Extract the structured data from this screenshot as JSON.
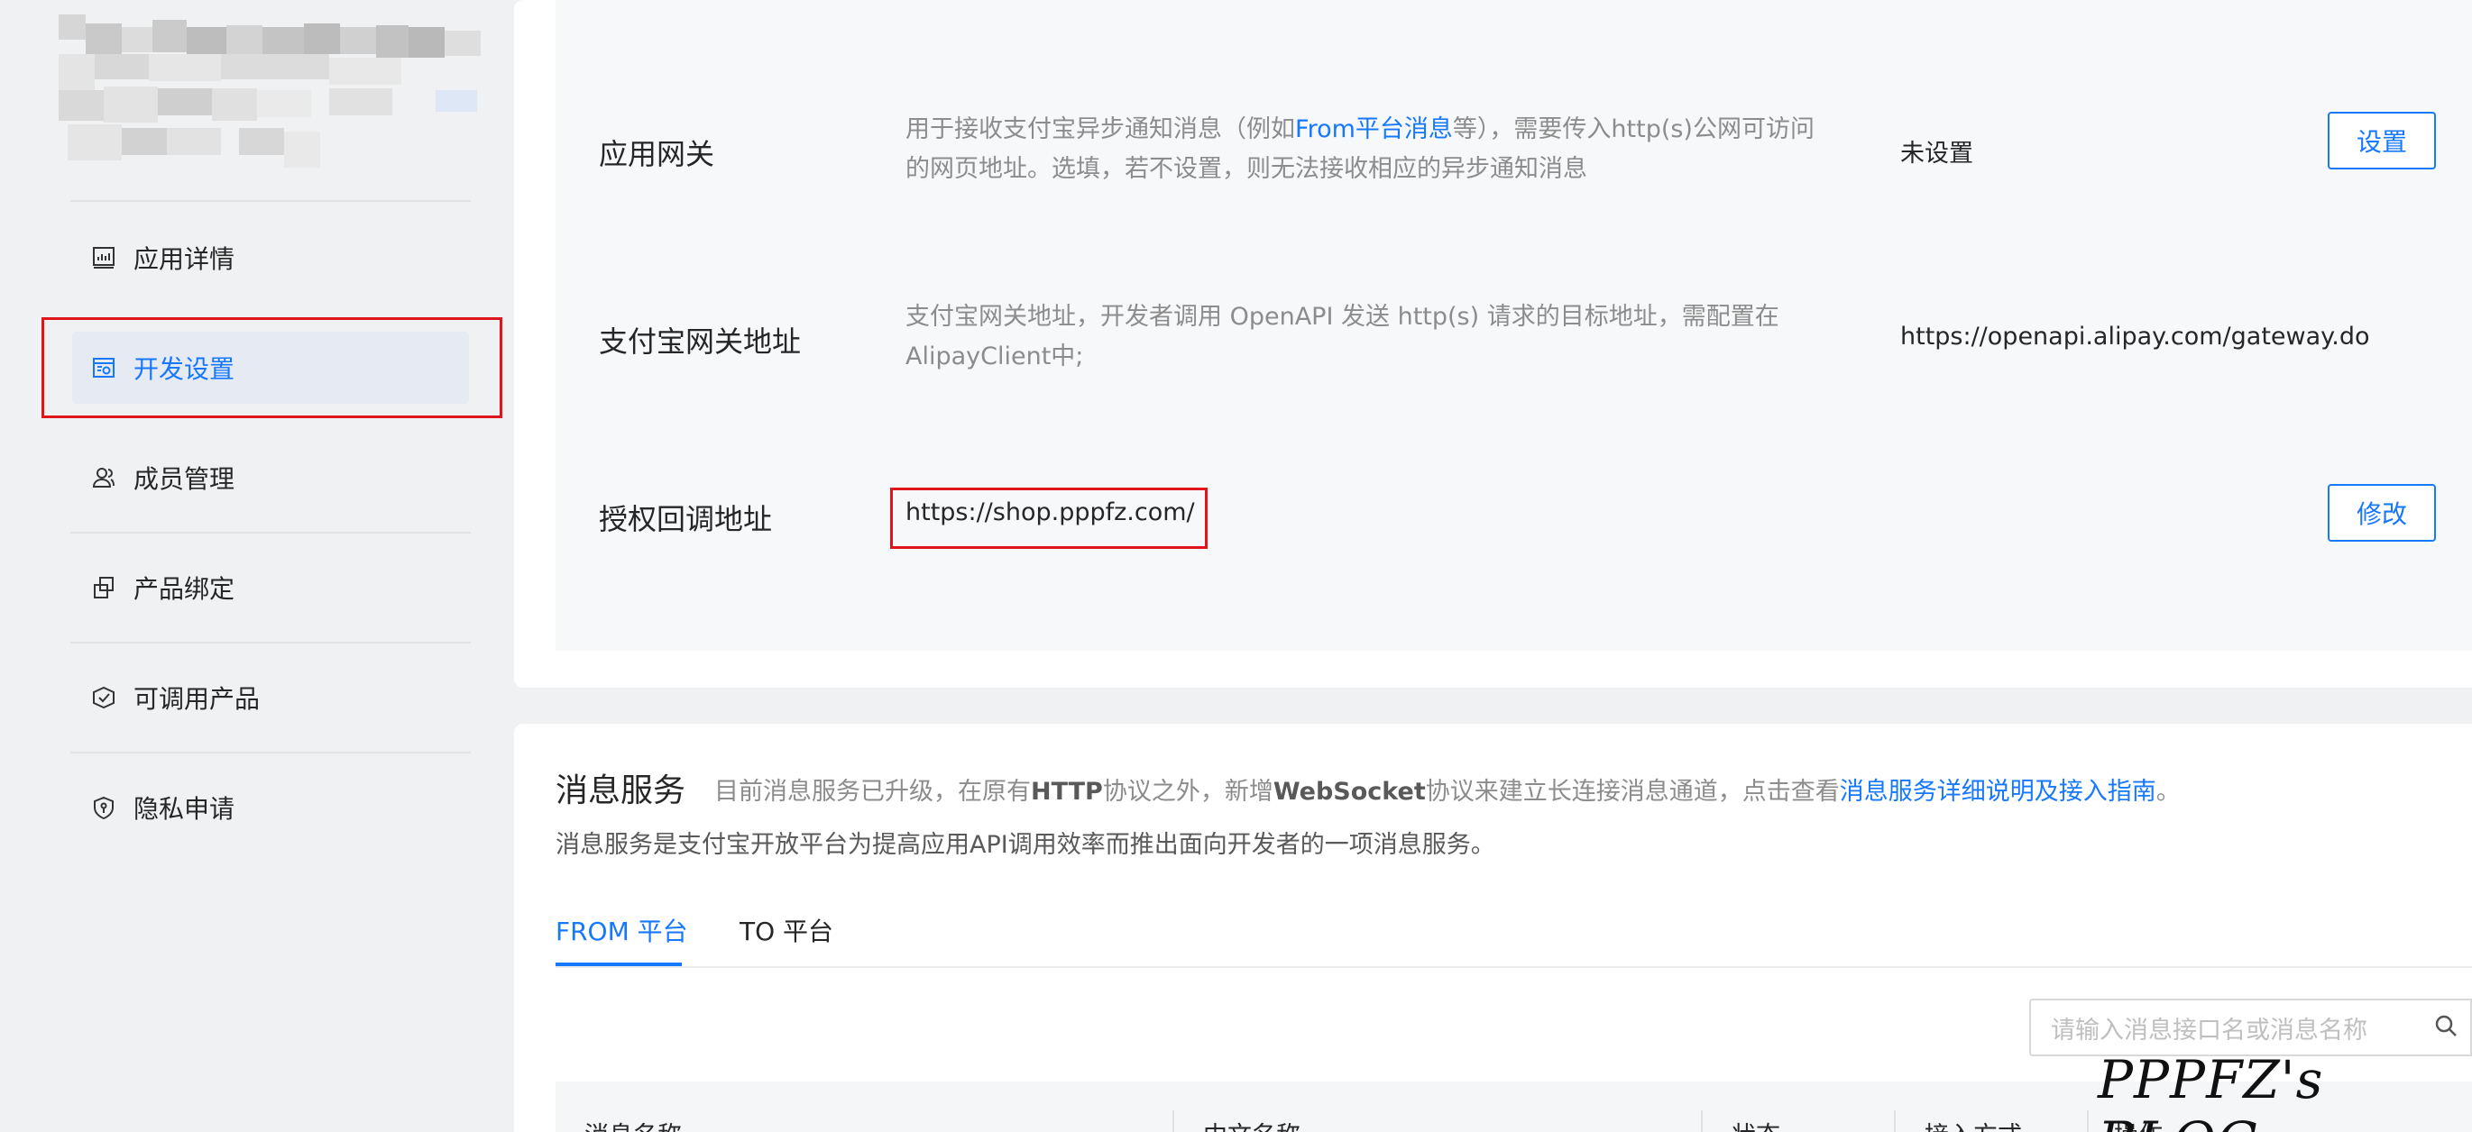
{
  "sidebar": {
    "items": [
      {
        "label": "应用详情",
        "icon": "chart-icon"
      },
      {
        "label": "开发设置",
        "icon": "settings-window-icon"
      },
      {
        "label": "成员管理",
        "icon": "members-icon"
      },
      {
        "label": "产品绑定",
        "icon": "link-icon"
      },
      {
        "label": "可调用产品",
        "icon": "product-icon"
      },
      {
        "label": "隐私申请",
        "icon": "shield-icon"
      }
    ]
  },
  "config": {
    "gateway": {
      "label": "应用网关",
      "desc_pre": "用于接收支付宝异步通知消息（例如",
      "desc_link": "From平台消息",
      "desc_post": "等），需要传入http(s)公网可访问的网页地址。选填，若不设置，则无法接收相应的异步通知消息",
      "value": "未设置",
      "button": "设置"
    },
    "alipay_gateway": {
      "label": "支付宝网关地址",
      "desc": "支付宝网关地址，开发者调用 OpenAPI 发送 http(s) 请求的目标地址，需配置在 AlipayClient中;",
      "value": "https://openapi.alipay.com/gateway.do"
    },
    "auth_callback": {
      "label": "授权回调地址",
      "value": "https://shop.pppfz.com/",
      "button": "修改"
    }
  },
  "message_service": {
    "title": "消息服务",
    "desc_pre": "目前消息服务已升级，在原有",
    "desc_b1": "HTTP",
    "desc_mid1": "协议之外，新增",
    "desc_b2": "WebSocket",
    "desc_mid2": "协议来建立长连接消息通道，点击查看",
    "desc_link": "消息服务详细说明及接入指南",
    "desc_end": "。",
    "desc2": "消息服务是支付宝开放平台为提高应用API调用效率而推出面向开发者的一项消息服务。",
    "tabs": [
      "FROM 平台",
      "TO 平台"
    ],
    "search_placeholder": "请输入消息接口名或消息名称",
    "table_headers": [
      "消息名称",
      "中文名称",
      "状态",
      "接入方式",
      "操作"
    ]
  },
  "watermark": "PPPFZ's BLOG",
  "colors": {
    "accent": "#1677ff",
    "highlight": "#e0151b"
  }
}
